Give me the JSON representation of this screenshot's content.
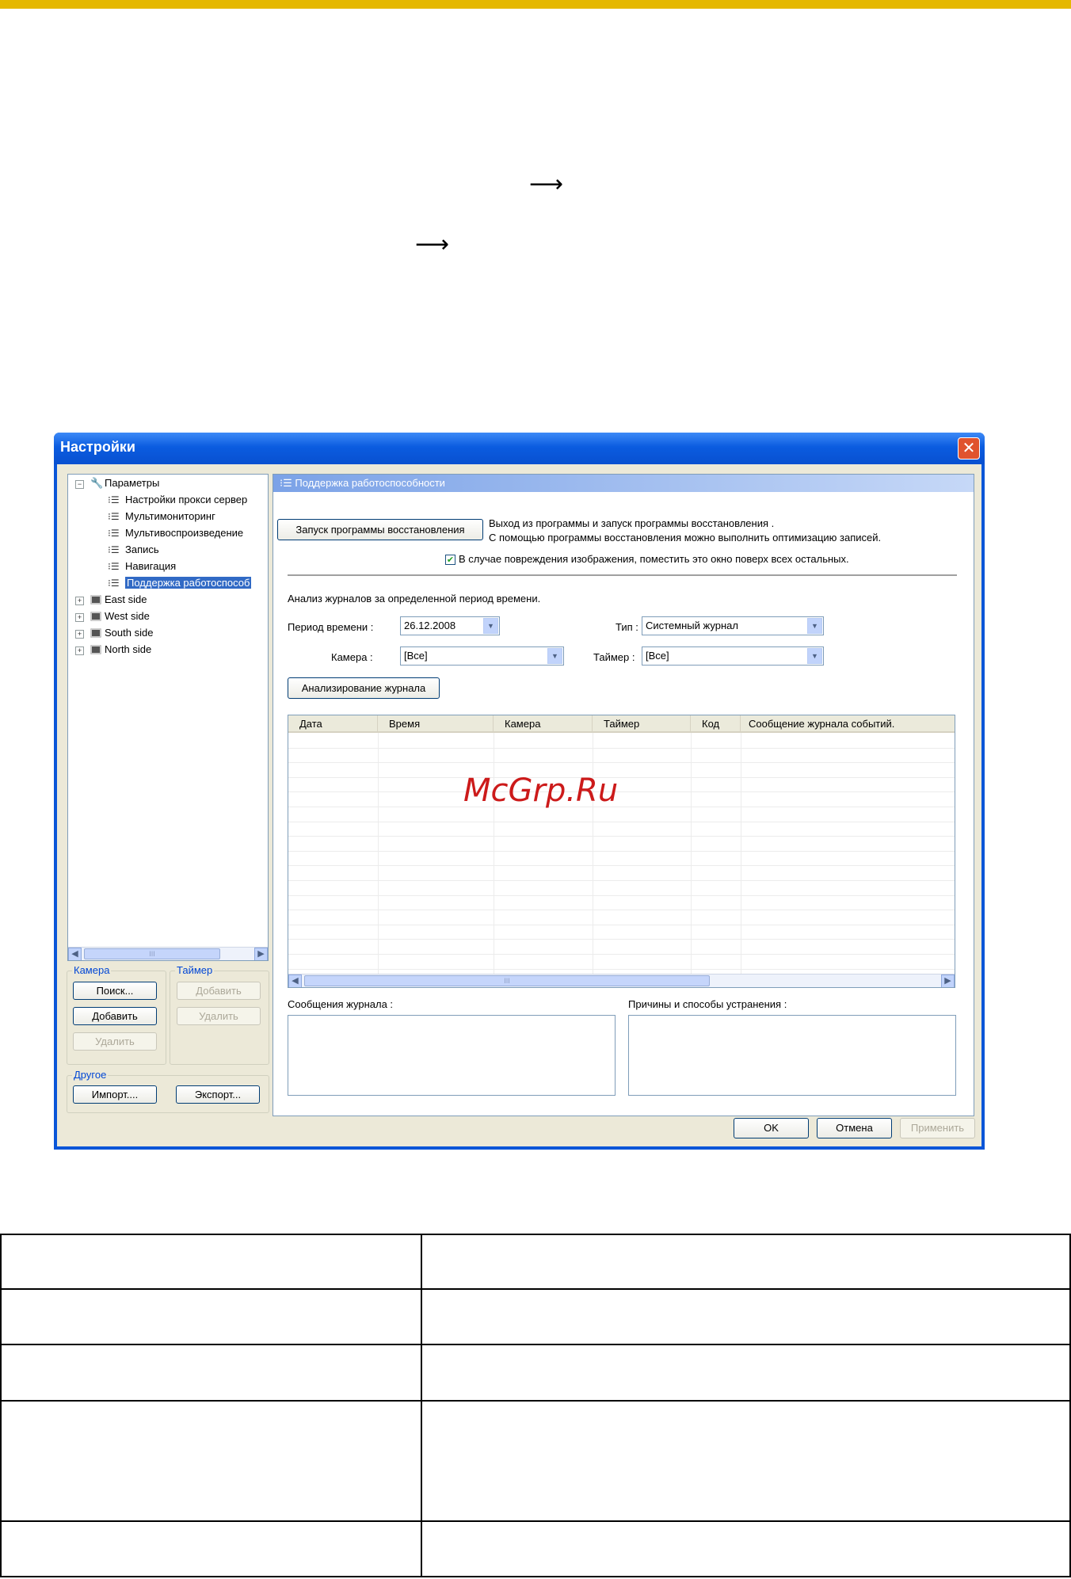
{
  "window": {
    "title": "Настройки",
    "close": "✕"
  },
  "tree": {
    "root": "Параметры",
    "children": [
      "Настройки прокси сервер",
      "Мультимониторинг",
      "Мультивоспроизведение",
      "Запись",
      "Навигация",
      "Поддержка работоспособ"
    ],
    "sites": [
      "East side",
      "West side",
      "South side",
      "North side"
    ],
    "scroll_thumb_label": "III"
  },
  "camera_group": {
    "label": "Камера",
    "search": "Поиск...",
    "add": "Добавить",
    "delete": "Удалить"
  },
  "timer_group": {
    "label": "Таймер",
    "add": "Добавить",
    "delete": "Удалить"
  },
  "other_group": {
    "label": "Другое",
    "import": "Импорт....",
    "export": "Экспорт..."
  },
  "panel": {
    "header": "Поддержка работоспособности",
    "recovery_button": "Запуск программы восстановления",
    "recovery_desc_1": "Выход из программы и запуск программы восстановления .",
    "recovery_desc_2": "С помощью программы восстановления можно выполнить оптимизацию записей.",
    "checkbox_label": "В случае повреждения изображения, поместить это окно поверх всех остальных.",
    "checkbox_checked": true,
    "analysis_title": "Анализ журналов за определенной период времени.",
    "period_label": "Период времени :",
    "period_value": "26.12.2008",
    "type_label": "Тип :",
    "type_value": "Системный журнал",
    "camera_label": "Камера :",
    "camera_value": "[Все]",
    "timer_label": "Таймер :",
    "timer_value": "[Все]",
    "analyze_button": "Анализирование журнала",
    "columns": [
      "Дата",
      "Время",
      "Камера",
      "Таймер",
      "Код",
      "Сообщение журнала событий."
    ],
    "log_messages_label": "Сообщения журнала :",
    "causes_label": "Причины и способы устранения :"
  },
  "footer": {
    "ok": "OK",
    "cancel": "Отмена",
    "apply": "Применить"
  },
  "watermark": "McGrp.Ru"
}
